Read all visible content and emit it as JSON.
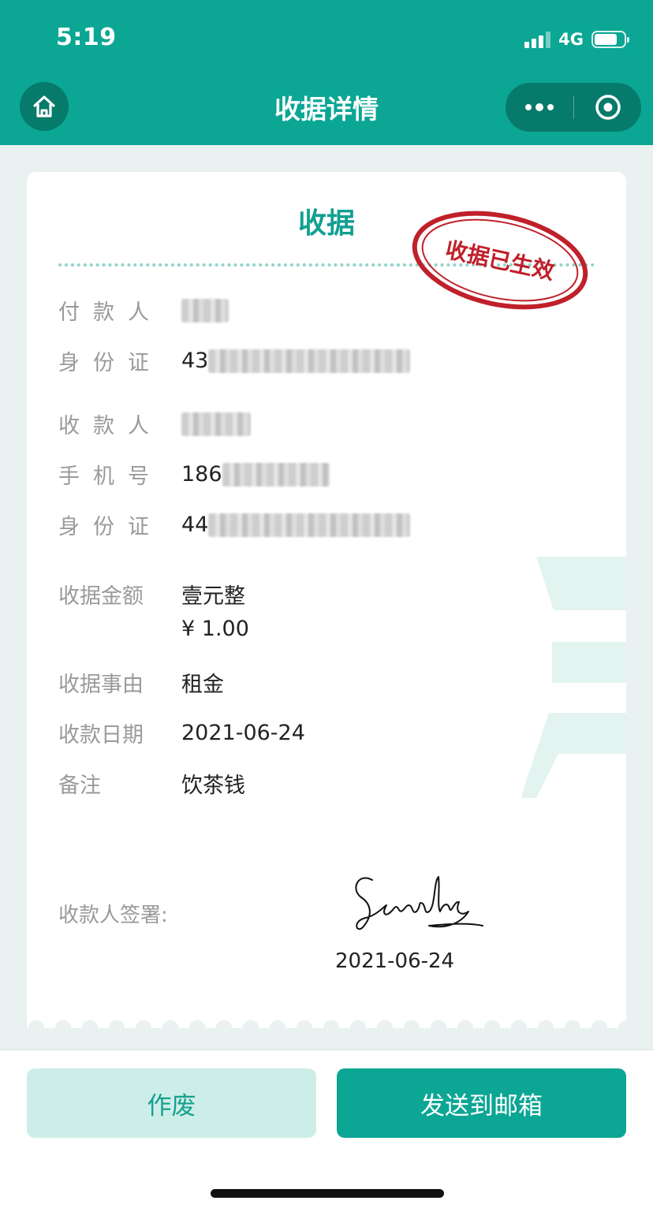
{
  "status_bar": {
    "time": "5:19",
    "network": "4G"
  },
  "nav": {
    "title": "收据详情",
    "home_icon": "home-icon",
    "more_icon": "more-dots-icon",
    "close_icon": "target-close-icon"
  },
  "receipt": {
    "title": "收据",
    "stamp_text": "收据已生效",
    "payer": {
      "label": "付款人",
      "value": ""
    },
    "payer_id": {
      "label": "身份证",
      "value_prefix": "43"
    },
    "payee": {
      "label": "收款人",
      "value": ""
    },
    "payee_phone": {
      "label": "手机号",
      "value_prefix": "186"
    },
    "payee_id": {
      "label": "身份证",
      "value_prefix": "44"
    },
    "amount": {
      "label": "收据金额",
      "value_words": "壹元整",
      "value_number": "¥ 1.00"
    },
    "reason": {
      "label": "收据事由",
      "value": "租金"
    },
    "date": {
      "label": "收款日期",
      "value": "2021-06-24"
    },
    "note": {
      "label": "备注",
      "value": "饮茶钱"
    },
    "signature": {
      "label": "收款人签署:",
      "date": "2021-06-24"
    }
  },
  "actions": {
    "void_label": "作废",
    "send_label": "发送到邮箱"
  },
  "colors": {
    "primary": "#0ba694",
    "primary_dark": "#067a6b",
    "light_button": "#cdeee8",
    "stamp": "#c0202a"
  }
}
